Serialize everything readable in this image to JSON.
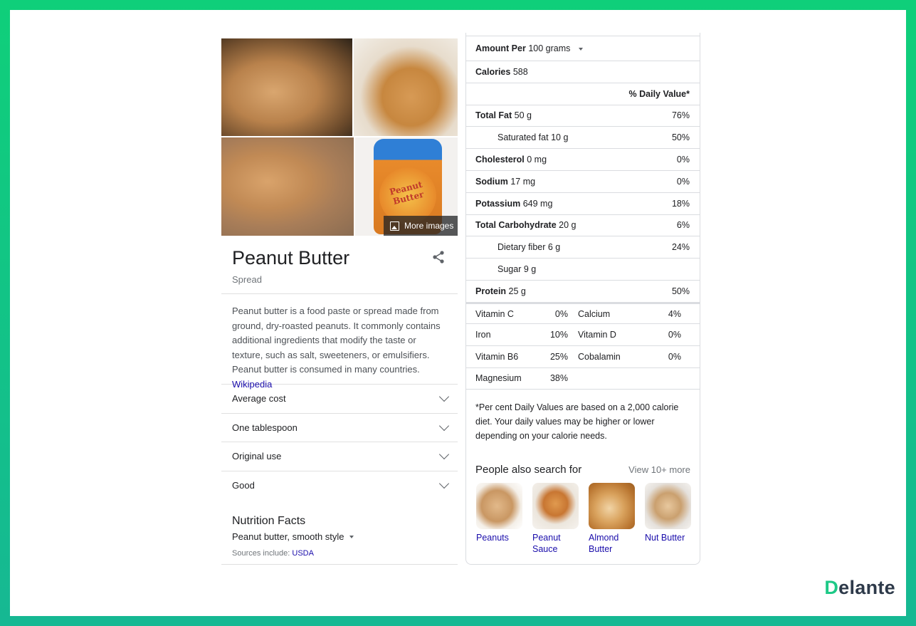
{
  "images": {
    "more_images_label": "More images",
    "jar_label": "Peanut Butter"
  },
  "entity": {
    "title": "Peanut Butter",
    "subtitle": "Spread",
    "description": "Peanut butter is a food paste or spread made from ground, dry-roasted peanuts. It commonly contains additional ingredients that modify the taste or texture, such as salt, sweeteners, or emulsifiers. Peanut butter is consumed in many countries.",
    "wiki_link": "Wikipedia"
  },
  "accordions": [
    "Average cost",
    "One tablespoon",
    "Original use",
    "Good"
  ],
  "nutrition": {
    "title": "Nutrition Facts",
    "selector": "Peanut butter, smooth style",
    "sources_prefix": "Sources include:",
    "sources_link": "USDA",
    "amount_label": "Amount Per",
    "amount_value": "100 grams",
    "calories_label": "Calories",
    "calories_value": "588",
    "dv_header": "% Daily Value*",
    "rows": [
      {
        "label": "Total Fat",
        "value": "50 g",
        "dv": "76%",
        "bold": true
      },
      {
        "label": "Saturated fat",
        "value": "10 g",
        "dv": "50%",
        "bold": false
      },
      {
        "label": "Cholesterol",
        "value": "0 mg",
        "dv": "0%",
        "bold": true
      },
      {
        "label": "Sodium",
        "value": "17 mg",
        "dv": "0%",
        "bold": true
      },
      {
        "label": "Potassium",
        "value": "649 mg",
        "dv": "18%",
        "bold": true
      },
      {
        "label": "Total Carbohydrate",
        "value": "20 g",
        "dv": "6%",
        "bold": true
      },
      {
        "label": "Dietary fiber",
        "value": "6 g",
        "dv": "24%",
        "bold": false
      },
      {
        "label": "Sugar",
        "value": "9 g",
        "dv": "",
        "bold": false
      },
      {
        "label": "Protein",
        "value": "25 g",
        "dv": "50%",
        "bold": true
      }
    ],
    "vitamins": [
      {
        "a_label": "Vitamin C",
        "a_value": "0%",
        "b_label": "Calcium",
        "b_value": "4%"
      },
      {
        "a_label": "Iron",
        "a_value": "10%",
        "b_label": "Vitamin D",
        "b_value": "0%"
      },
      {
        "a_label": "Vitamin B6",
        "a_value": "25%",
        "b_label": "Cobalamin",
        "b_value": "0%"
      },
      {
        "a_label": "Magnesium",
        "a_value": "38%",
        "b_label": "",
        "b_value": ""
      }
    ],
    "footnote": "*Per cent Daily Values are based on a 2,000 calorie diet. Your daily values may be higher or lower depending on your calorie needs."
  },
  "people_also_search": {
    "title": "People also search for",
    "more": "View 10+ more",
    "items": [
      "Peanuts",
      "Peanut Sauce",
      "Almond Butter",
      "Nut Butter"
    ]
  },
  "brand": {
    "logo_first": "D",
    "logo_rest": "elante"
  }
}
